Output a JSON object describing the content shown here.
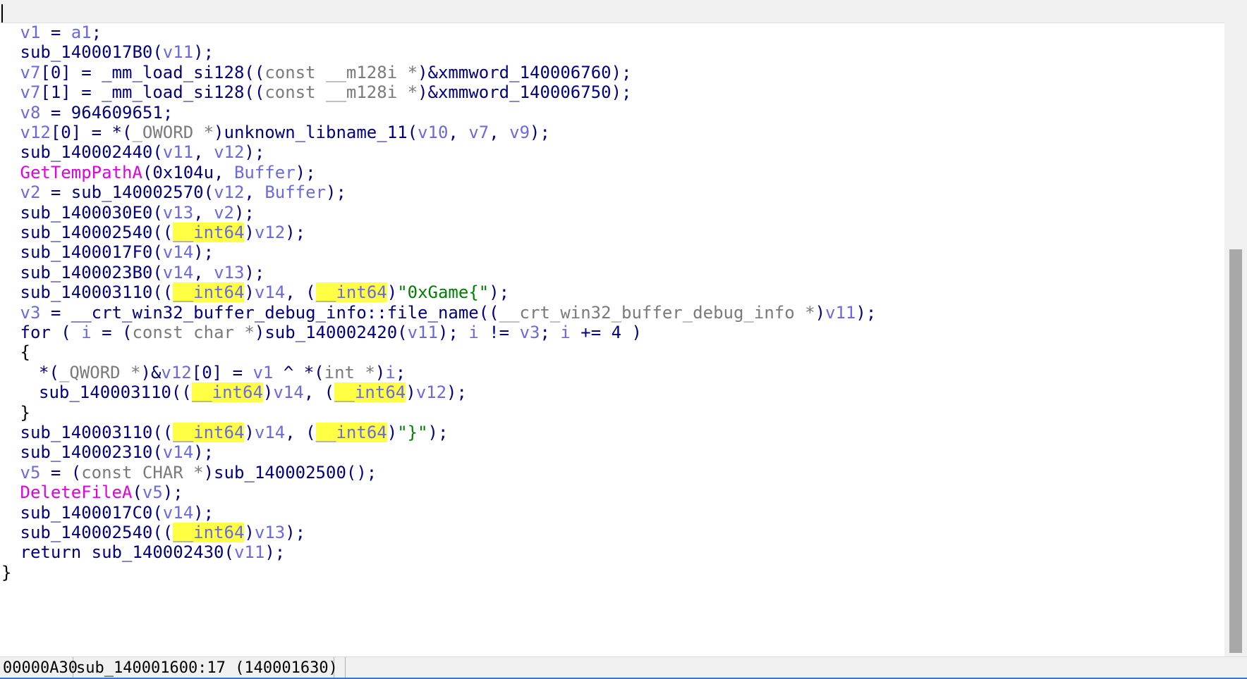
{
  "code": {
    "lines": [
      {
        "indent": 1,
        "tokens": [
          [
            "v1",
            "var"
          ],
          [
            " = ",
            "punct"
          ],
          [
            "a1",
            "var"
          ],
          [
            ";",
            "punct"
          ]
        ]
      },
      {
        "indent": 1,
        "tokens": [
          [
            "sub_1400017B0",
            "func"
          ],
          [
            "(",
            "punct"
          ],
          [
            "v11",
            "var"
          ],
          [
            ");",
            "punct"
          ]
        ]
      },
      {
        "indent": 1,
        "tokens": [
          [
            "v7",
            "var"
          ],
          [
            "[0] = ",
            "punct"
          ],
          [
            "_mm_load_si128",
            "func"
          ],
          [
            "((",
            "punct"
          ],
          [
            "const __m128i *",
            "type"
          ],
          [
            ")&",
            "punct"
          ],
          [
            "xmmword_140006760",
            "func"
          ],
          [
            ");",
            "punct"
          ]
        ]
      },
      {
        "indent": 1,
        "tokens": [
          [
            "v7",
            "var"
          ],
          [
            "[1] = ",
            "punct"
          ],
          [
            "_mm_load_si128",
            "func"
          ],
          [
            "((",
            "punct"
          ],
          [
            "const __m128i *",
            "type"
          ],
          [
            ")&",
            "punct"
          ],
          [
            "xmmword_140006750",
            "func"
          ],
          [
            ");",
            "punct"
          ]
        ]
      },
      {
        "indent": 1,
        "tokens": [
          [
            "v8",
            "var"
          ],
          [
            " = ",
            "punct"
          ],
          [
            "964609651",
            "num"
          ],
          [
            ";",
            "punct"
          ]
        ]
      },
      {
        "indent": 1,
        "tokens": [
          [
            "v12",
            "var"
          ],
          [
            "[0] = *(",
            "punct"
          ],
          [
            "_OWORD *",
            "type"
          ],
          [
            ")",
            "punct"
          ],
          [
            "unknown_libname_11",
            "func"
          ],
          [
            "(",
            "punct"
          ],
          [
            "v10",
            "var"
          ],
          [
            ", ",
            "punct"
          ],
          [
            "v7",
            "var"
          ],
          [
            ", ",
            "punct"
          ],
          [
            "v9",
            "var"
          ],
          [
            ");",
            "punct"
          ]
        ]
      },
      {
        "indent": 1,
        "tokens": [
          [
            "sub_140002440",
            "func"
          ],
          [
            "(",
            "punct"
          ],
          [
            "v11",
            "var"
          ],
          [
            ", ",
            "punct"
          ],
          [
            "v12",
            "var"
          ],
          [
            ");",
            "punct"
          ]
        ]
      },
      {
        "indent": 1,
        "tokens": [
          [
            "GetTempPathA",
            "api"
          ],
          [
            "(",
            "punct"
          ],
          [
            "0x104u",
            "num"
          ],
          [
            ", ",
            "punct"
          ],
          [
            "Buffer",
            "var"
          ],
          [
            ");",
            "punct"
          ]
        ]
      },
      {
        "indent": 1,
        "tokens": [
          [
            "v2",
            "var"
          ],
          [
            " = ",
            "punct"
          ],
          [
            "sub_140002570",
            "func"
          ],
          [
            "(",
            "punct"
          ],
          [
            "v12",
            "var"
          ],
          [
            ", ",
            "punct"
          ],
          [
            "Buffer",
            "var"
          ],
          [
            ");",
            "punct"
          ]
        ]
      },
      {
        "indent": 1,
        "tokens": [
          [
            "sub_1400030E0",
            "func"
          ],
          [
            "(",
            "punct"
          ],
          [
            "v13",
            "var"
          ],
          [
            ", ",
            "punct"
          ],
          [
            "v2",
            "var"
          ],
          [
            ");",
            "punct"
          ]
        ]
      },
      {
        "indent": 1,
        "tokens": [
          [
            "sub_140002540",
            "func"
          ],
          [
            "((",
            "punct"
          ],
          [
            "__int64",
            "hl"
          ],
          [
            ")",
            "punct"
          ],
          [
            "v12",
            "var"
          ],
          [
            ");",
            "punct"
          ]
        ]
      },
      {
        "indent": 1,
        "tokens": [
          [
            "sub_1400017F0",
            "func"
          ],
          [
            "(",
            "punct"
          ],
          [
            "v14",
            "var"
          ],
          [
            ");",
            "punct"
          ]
        ]
      },
      {
        "indent": 1,
        "tokens": [
          [
            "sub_1400023B0",
            "func"
          ],
          [
            "(",
            "punct"
          ],
          [
            "v14",
            "var"
          ],
          [
            ", ",
            "punct"
          ],
          [
            "v13",
            "var"
          ],
          [
            ");",
            "punct"
          ]
        ]
      },
      {
        "indent": 1,
        "tokens": [
          [
            "sub_140003110",
            "func"
          ],
          [
            "((",
            "punct"
          ],
          [
            "__int64",
            "hl"
          ],
          [
            ")",
            "punct"
          ],
          [
            "v14",
            "var"
          ],
          [
            ", (",
            "punct"
          ],
          [
            "__int64",
            "hl"
          ],
          [
            ")",
            "punct"
          ],
          [
            "\"0xGame{\"",
            "str"
          ],
          [
            ");",
            "punct"
          ]
        ]
      },
      {
        "indent": 1,
        "tokens": [
          [
            "v3",
            "var"
          ],
          [
            " = ",
            "punct"
          ],
          [
            "__crt_win32_buffer_debug_info::file_name",
            "func"
          ],
          [
            "((",
            "punct"
          ],
          [
            "__crt_win32_buffer_debug_info *",
            "type"
          ],
          [
            ")",
            "punct"
          ],
          [
            "v11",
            "var"
          ],
          [
            ");",
            "punct"
          ]
        ]
      },
      {
        "indent": 1,
        "tokens": [
          [
            "for",
            "kw"
          ],
          [
            " ( ",
            "punct"
          ],
          [
            "i",
            "var"
          ],
          [
            " = (",
            "punct"
          ],
          [
            "const char *",
            "type"
          ],
          [
            ")",
            "punct"
          ],
          [
            "sub_140002420",
            "func"
          ],
          [
            "(",
            "punct"
          ],
          [
            "v11",
            "var"
          ],
          [
            "); ",
            "punct"
          ],
          [
            "i",
            "var"
          ],
          [
            " != ",
            "punct"
          ],
          [
            "v3",
            "var"
          ],
          [
            "; ",
            "punct"
          ],
          [
            "i",
            "var"
          ],
          [
            " += ",
            "punct"
          ],
          [
            "4",
            "num"
          ],
          [
            " )",
            "punct"
          ]
        ]
      },
      {
        "indent": 1,
        "tokens": [
          [
            "{",
            "brace"
          ]
        ]
      },
      {
        "indent": 2,
        "tokens": [
          [
            "*(",
            "punct"
          ],
          [
            "_QWORD *",
            "type"
          ],
          [
            ")&",
            "punct"
          ],
          [
            "v12",
            "var"
          ],
          [
            "[0] = ",
            "punct"
          ],
          [
            "v1",
            "var"
          ],
          [
            " ^ *(",
            "punct"
          ],
          [
            "int *",
            "type"
          ],
          [
            ")",
            "punct"
          ],
          [
            "i",
            "var"
          ],
          [
            ";",
            "punct"
          ]
        ]
      },
      {
        "indent": 2,
        "tokens": [
          [
            "sub_140003110",
            "func"
          ],
          [
            "((",
            "punct"
          ],
          [
            "__int64",
            "hl"
          ],
          [
            ")",
            "punct"
          ],
          [
            "v14",
            "var"
          ],
          [
            ", (",
            "punct"
          ],
          [
            "__int64",
            "hl"
          ],
          [
            ")",
            "punct"
          ],
          [
            "v12",
            "var"
          ],
          [
            ");",
            "punct"
          ]
        ]
      },
      {
        "indent": 1,
        "tokens": [
          [
            "}",
            "brace"
          ]
        ]
      },
      {
        "indent": 1,
        "tokens": [
          [
            "sub_140003110",
            "func"
          ],
          [
            "((",
            "punct"
          ],
          [
            "__int64",
            "hl"
          ],
          [
            ")",
            "punct"
          ],
          [
            "v14",
            "var"
          ],
          [
            ", (",
            "punct"
          ],
          [
            "__int64",
            "hl"
          ],
          [
            ")",
            "punct"
          ],
          [
            "\"}\"",
            "str"
          ],
          [
            ");",
            "punct"
          ]
        ]
      },
      {
        "indent": 1,
        "tokens": [
          [
            "sub_140002310",
            "func"
          ],
          [
            "(",
            "punct"
          ],
          [
            "v14",
            "var"
          ],
          [
            ");",
            "punct"
          ]
        ]
      },
      {
        "indent": 1,
        "tokens": [
          [
            "v5",
            "var"
          ],
          [
            " = (",
            "punct"
          ],
          [
            "const CHAR *",
            "type"
          ],
          [
            ")",
            "punct"
          ],
          [
            "sub_140002500",
            "func"
          ],
          [
            "();",
            "punct"
          ]
        ]
      },
      {
        "indent": 1,
        "tokens": [
          [
            "DeleteFileA",
            "api"
          ],
          [
            "(",
            "punct"
          ],
          [
            "v5",
            "var"
          ],
          [
            ");",
            "punct"
          ]
        ]
      },
      {
        "indent": 1,
        "tokens": [
          [
            "sub_1400017C0",
            "func"
          ],
          [
            "(",
            "punct"
          ],
          [
            "v14",
            "var"
          ],
          [
            ");",
            "punct"
          ]
        ]
      },
      {
        "indent": 1,
        "tokens": [
          [
            "sub_140002540",
            "func"
          ],
          [
            "((",
            "punct"
          ],
          [
            "__int64",
            "hl"
          ],
          [
            ")",
            "punct"
          ],
          [
            "v13",
            "var"
          ],
          [
            ");",
            "punct"
          ]
        ]
      },
      {
        "indent": 1,
        "tokens": [
          [
            "return",
            "kw"
          ],
          [
            " ",
            "punct"
          ],
          [
            "sub_140002430",
            "func"
          ],
          [
            "(",
            "punct"
          ],
          [
            "v11",
            "var"
          ],
          [
            ");",
            "punct"
          ]
        ]
      },
      {
        "indent": 0,
        "tokens": [
          [
            "}",
            "brace"
          ]
        ]
      }
    ]
  },
  "status_bar": {
    "offset": "00000A30",
    "location": "sub_140001600:17 (140001630)"
  },
  "scrollbar": {
    "thumb_start_fraction": 0.38,
    "thumb_end_fraction": 0.995
  },
  "colors": {
    "variable": "#6a6ae0",
    "function": "#000080",
    "api_call": "#e000e0",
    "string": "#008000",
    "type_cast": "#7a7a7a",
    "highlight": "#ffff44"
  }
}
